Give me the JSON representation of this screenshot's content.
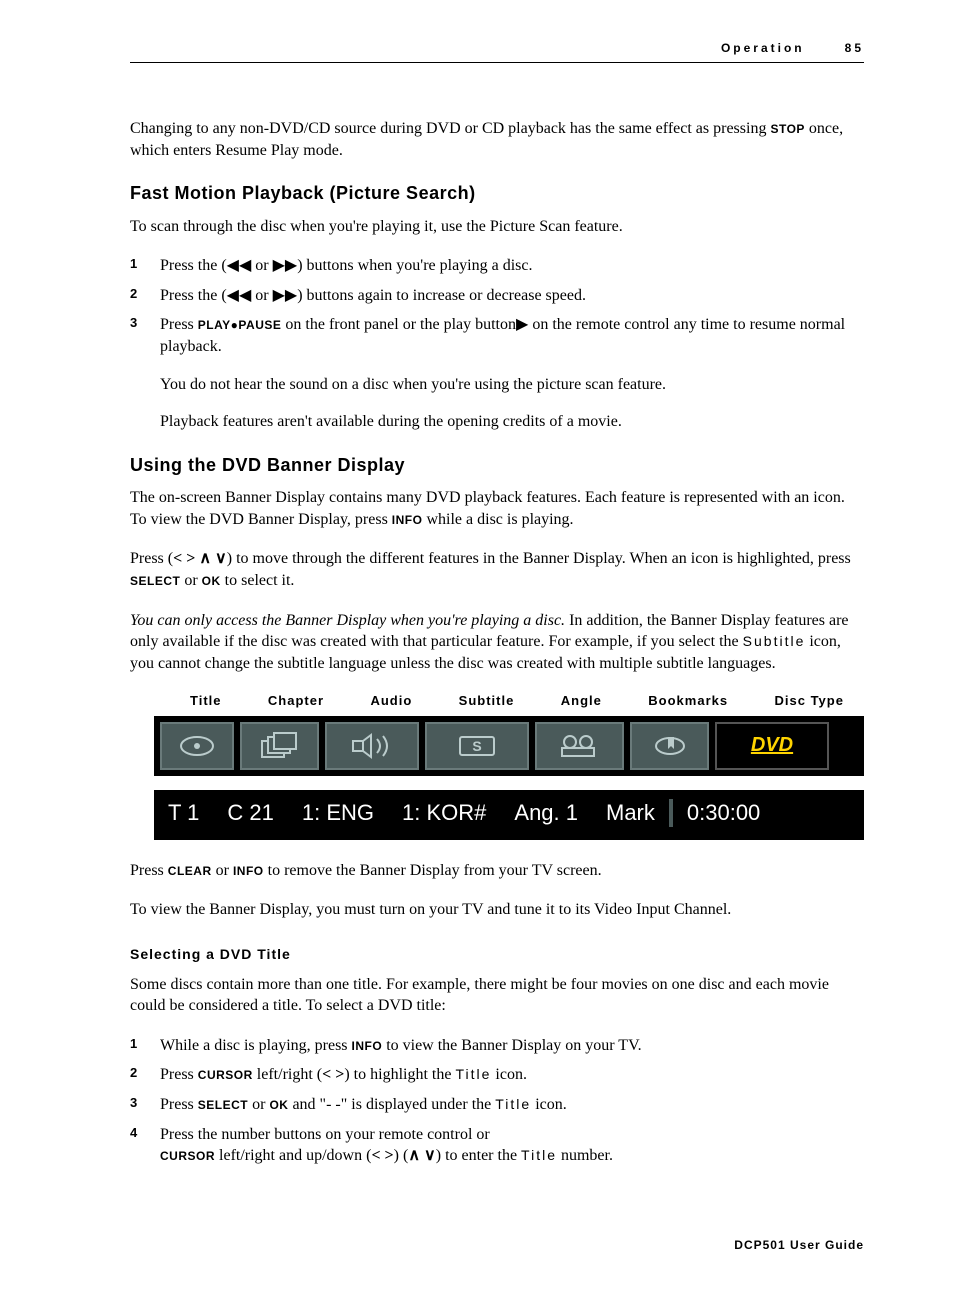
{
  "header": {
    "section": "Operation",
    "page": "85"
  },
  "intro": "Changing to any non-DVD/CD source during DVD or CD playback has the same effect as pressing ",
  "intro_key": "STOP",
  "intro_tail": " once, which enters Resume Play mode.",
  "fast": {
    "title": "Fast Motion Playback (Picture Search)",
    "lead": "To scan through the disc when you're playing it, use the Picture Scan feature.",
    "steps": [
      {
        "n": "1",
        "a": "Press the (",
        "b": " or ",
        "c": ") buttons when you're playing a disc."
      },
      {
        "n": "2",
        "a": "Press the (",
        "b": " or ",
        "c": ") buttons again to increase or decrease speed."
      },
      {
        "n": "3",
        "a": "Press ",
        "key": "PLAY●PAUSE",
        "b": " on the front panel or the play button",
        "c": " on the remote control any time to resume normal playback."
      }
    ],
    "note1": "You do not hear the sound on a disc when you're using the picture scan feature.",
    "note2": "Playback features aren't available during the opening credits of a movie."
  },
  "banner": {
    "title": "Using the DVD Banner Display",
    "p1a": "The on-screen Banner Display contains many DVD playback features. Each feature is represented with an icon. To view the DVD Banner Display, press ",
    "p1key": "INFO",
    "p1b": " while a disc is playing.",
    "p2a": "Press (",
    "arrows": "< > ∧ ∨",
    "p2b": ") to move through the different features in the Banner Display. When an icon is highlighted, press ",
    "p2key1": "SELECT",
    "p2or": " or ",
    "p2key2": "OK",
    "p2c": " to select it.",
    "p3a": "You can only access the Banner Display when you're playing a disc.",
    "p3b": " In addition, the Banner Display features are only available if the disc was created with that particular feature. For example, if you select the ",
    "p3sub": "Subtitle",
    "p3c": " icon, you cannot change the subtitle language unless the disc was created with multiple subtitle languages.",
    "labels": [
      "Title",
      "Chapter",
      "Audio",
      "Subtitle",
      "Angle",
      "Bookmarks",
      "Disc Type"
    ],
    "row": {
      "t": "T 1",
      "c": "C 21",
      "aud": "1: ENG",
      "sub": "1: KOR#",
      "ang": "Ang. 1",
      "mark": "Mark",
      "time": "0:30:00"
    },
    "dvd": "DVD",
    "after1a": "Press ",
    "after1k1": "CLEAR",
    "after1or": " or ",
    "after1k2": "INFO",
    "after1b": " to remove the Banner Display from your TV screen.",
    "after2": "To view the Banner Display, you must turn on your TV and tune it to its Video Input Channel."
  },
  "select": {
    "title": "Selecting a DVD Title",
    "lead": "Some discs contain more than one title. For example, there might be four movies on one disc and each movie could be considered a title. To select a DVD title:",
    "s1a": "While a disc is playing, press ",
    "s1k": "INFO",
    "s1b": " to view the Banner Display on your TV.",
    "s2a": "Press ",
    "s2k": "CURSOR",
    "s2b": " left/right (",
    "s2arr": "< >",
    "s2c": ") to highlight the ",
    "s2title": "Title",
    "s2d": " icon.",
    "s3a": "Press ",
    "s3k1": "SELECT",
    "s3or": " or ",
    "s3k2": "OK",
    "s3b": " and \"- -\" is displayed under the ",
    "s3title": "Title",
    "s3c": " icon.",
    "s4a": "Press the number buttons on your remote control or",
    "s4k": "CURSOR",
    "s4b": " left/right and up/down (",
    "s4a1": "< >",
    "s4c": ") (",
    "s4a2": "∧ ∨",
    "s4d": ") to enter the ",
    "s4title": "Title",
    "s4e": " number."
  },
  "footer": "DCP501 User Guide"
}
